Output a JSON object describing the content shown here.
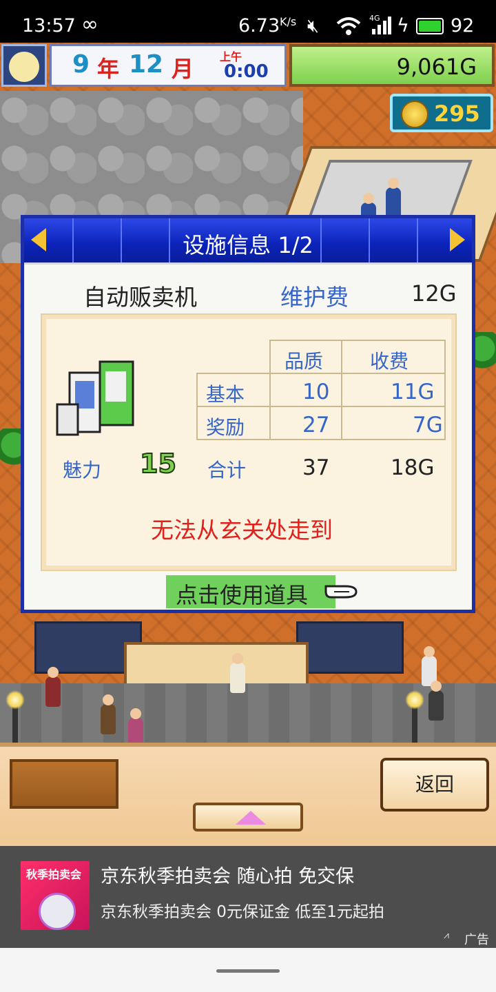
{
  "status_bar": {
    "time": "13:57",
    "network_speed": "6.73",
    "network_unit": "K/s",
    "signal_label": "4G",
    "battery": "92",
    "icons": [
      "infinity-icon",
      "mute-icon",
      "wifi-icon",
      "signal-icon",
      "charging-icon",
      "battery-icon"
    ]
  },
  "hud": {
    "year": "9",
    "year_unit": "年",
    "month": "12",
    "month_unit": "月",
    "period": "上午",
    "clock": "0:00",
    "money": "9,061G",
    "coins": "295"
  },
  "dialog": {
    "title": "设施信息 1/2",
    "facility_name": "自动贩卖机",
    "upkeep_label": "维护费",
    "upkeep_value": "12G",
    "col_quality": "品质",
    "col_fee": "收费",
    "row_basic": "基本",
    "basic_quality": "10",
    "basic_fee": "11G",
    "row_bonus": "奖励",
    "bonus_quality": "27",
    "bonus_fee": "7G",
    "charm_label": "魅力",
    "charm_value": "15",
    "total_label": "合计",
    "total_quality": "37",
    "total_fee": "18G",
    "warning": "无法从玄关处走到",
    "use_item_button": "点击使用道具"
  },
  "bottom": {
    "back_button": "返回"
  },
  "ad": {
    "title": "京东秋季拍卖会 随心拍 免交保",
    "subtitle": "京东秋季拍卖会 0元保证金 低至1元起拍",
    "image_text": "秋季拍卖会",
    "badge": "广告"
  },
  "colors": {
    "dialog_header": "#0b22b8",
    "label_blue": "#3565c8",
    "warning_red": "#e0211b",
    "button_green": "#6fd05c"
  }
}
